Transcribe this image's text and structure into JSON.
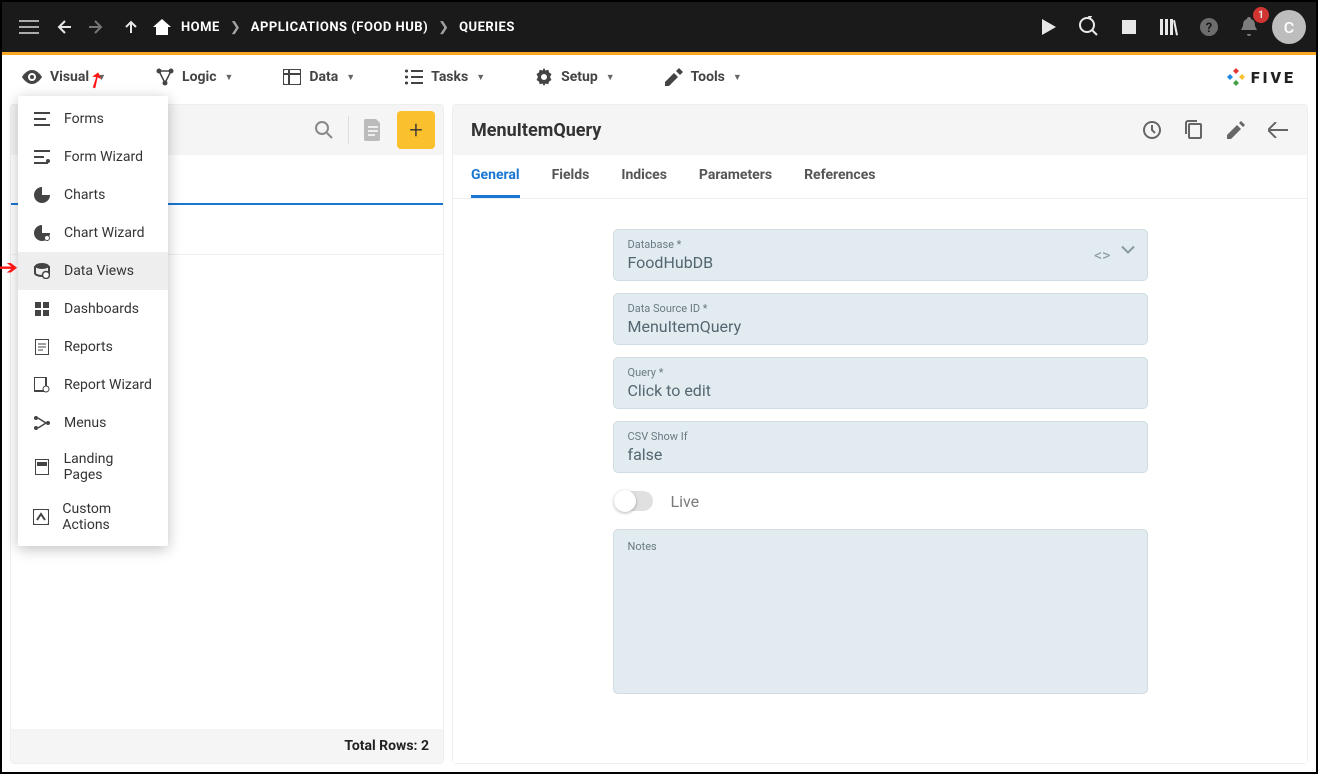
{
  "topbar": {
    "home": "HOME",
    "apps": "APPLICATIONS (FOOD HUB)",
    "queries": "QUERIES",
    "avatar": "C",
    "notif_count": "1"
  },
  "menuStrip": {
    "visual": "Visual",
    "logic": "Logic",
    "data": "Data",
    "tasks": "Tasks",
    "setup": "Setup",
    "tools": "Tools",
    "brand": "FIVE"
  },
  "dropdown": {
    "forms": "Forms",
    "formWizard": "Form Wizard",
    "charts": "Charts",
    "chartWizard": "Chart Wizard",
    "dataViews": "Data Views",
    "dashboards": "Dashboards",
    "reports": "Reports",
    "reportWizard": "Report Wizard",
    "menus": "Menus",
    "landingPages": "Landing Pages",
    "customActions": "Custom Actions"
  },
  "leftPanel": {
    "footer_label": "Total Rows:",
    "footer_value": "2"
  },
  "rightPanel": {
    "title": "MenuItemQuery",
    "tabs": {
      "general": "General",
      "fields": "Fields",
      "indices": "Indices",
      "parameters": "Parameters",
      "references": "References"
    },
    "form": {
      "database_label": "Database *",
      "database_value": "FoodHubDB",
      "dsid_label": "Data Source ID *",
      "dsid_value": "MenuItemQuery",
      "query_label": "Query *",
      "query_value": "Click to edit",
      "csv_label": "CSV Show If",
      "csv_value": "false",
      "live_label": "Live",
      "notes_label": "Notes"
    }
  }
}
